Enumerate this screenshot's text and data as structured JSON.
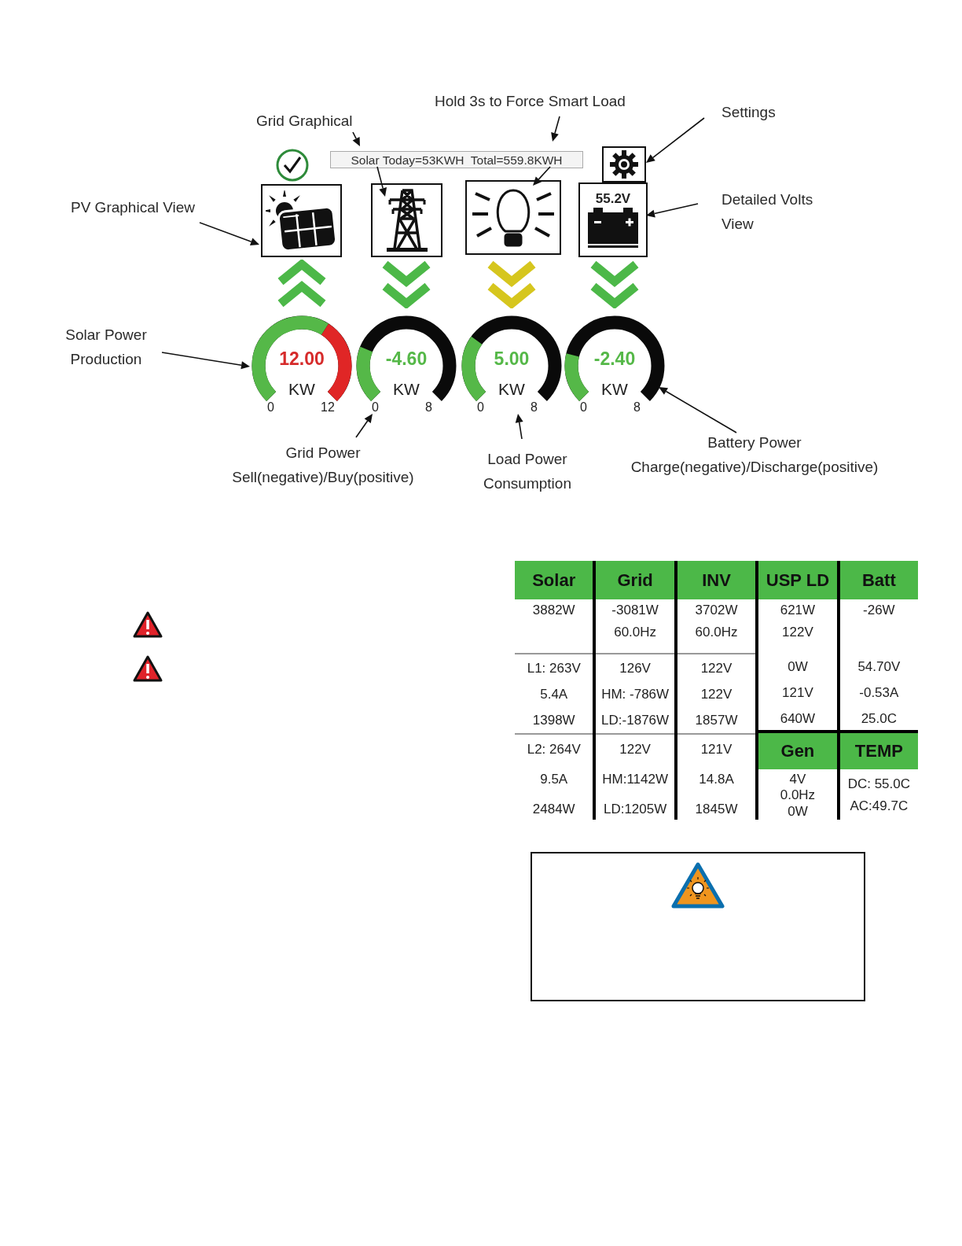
{
  "diagram": {
    "annotations": [
      {
        "lines": [
          "Hold 3s to Force Smart Load"
        ]
      },
      {
        "lines": [
          "Grid Graphical"
        ]
      },
      {
        "lines": [
          "Settings"
        ]
      },
      {
        "lines": [
          "PV Graphical View"
        ]
      },
      {
        "lines": [
          "Detailed Volts",
          "View"
        ]
      },
      {
        "lines": [
          "Solar Power",
          "Production"
        ]
      },
      {
        "lines": [
          "Battery Power",
          "Charge(negative)/Discharge(positive)"
        ]
      },
      {
        "lines": [
          "Grid Power",
          "Sell(negative)/Buy(positive)"
        ]
      },
      {
        "lines": [
          "Load Power",
          "Consumption"
        ]
      }
    ],
    "summary": "Solar Today=53KWH  Total=559.8KWH",
    "devices": [
      {
        "kind": "solar",
        "upward": true,
        "color": "#4cb848"
      },
      {
        "kind": "grid",
        "upward": false,
        "color": "#4cb848"
      },
      {
        "kind": "load",
        "upward": false,
        "color": "#d6c61e"
      },
      {
        "kind": "battery",
        "reading": "55.2V",
        "upward": false,
        "color": "#4cb848"
      }
    ],
    "gauges": [
      {
        "value": "12.00",
        "unit": "KW",
        "min": "0",
        "max": "12",
        "alert": true
      },
      {
        "value": "-4.60",
        "unit": "KW",
        "min": "0",
        "max": "8",
        "alert": false
      },
      {
        "value": "5.00",
        "unit": "KW",
        "min": "0",
        "max": "8",
        "alert": false
      },
      {
        "value": "-2.40",
        "unit": "KW",
        "min": "0",
        "max": "8",
        "alert": false
      }
    ]
  },
  "table": {
    "columns": [
      {
        "header": "Solar",
        "rules": true,
        "blocks": [
          [
            "3882W"
          ],
          [
            "L1: 263V",
            "5.4A",
            "1398W"
          ],
          [
            "L2: 264V",
            "9.5A",
            "2484W"
          ]
        ]
      },
      {
        "header": "Grid",
        "rules": true,
        "blocks": [
          [
            "-3081W",
            "60.0Hz"
          ],
          [
            "126V",
            "HM: -786W",
            "LD:-1876W"
          ],
          [
            "122V",
            "HM:1142W",
            "LD:1205W"
          ]
        ]
      },
      {
        "header": "INV",
        "rules": true,
        "blocks": [
          [
            "3702W",
            "60.0Hz"
          ],
          [
            "122V",
            "122V",
            "1857W"
          ],
          [
            "121V",
            "14.8A",
            "1845W"
          ]
        ]
      },
      {
        "header": "USP LD",
        "rules": false,
        "blocks": [
          [
            "621W",
            "122V"
          ],
          [
            "0W",
            "121V",
            "640W"
          ]
        ],
        "subheader": "Gen",
        "sub_blocks": [
          [
            "4V",
            "0.0Hz",
            "0W"
          ]
        ]
      },
      {
        "header": "Batt",
        "rules": false,
        "blocks": [
          [
            "-26W"
          ],
          [
            "54.70V",
            "-0.53A",
            "25.0C"
          ]
        ],
        "subheader": "TEMP",
        "sub_blocks": [
          [
            "DC: 55.0C",
            "AC:49.7C"
          ]
        ]
      }
    ]
  }
}
